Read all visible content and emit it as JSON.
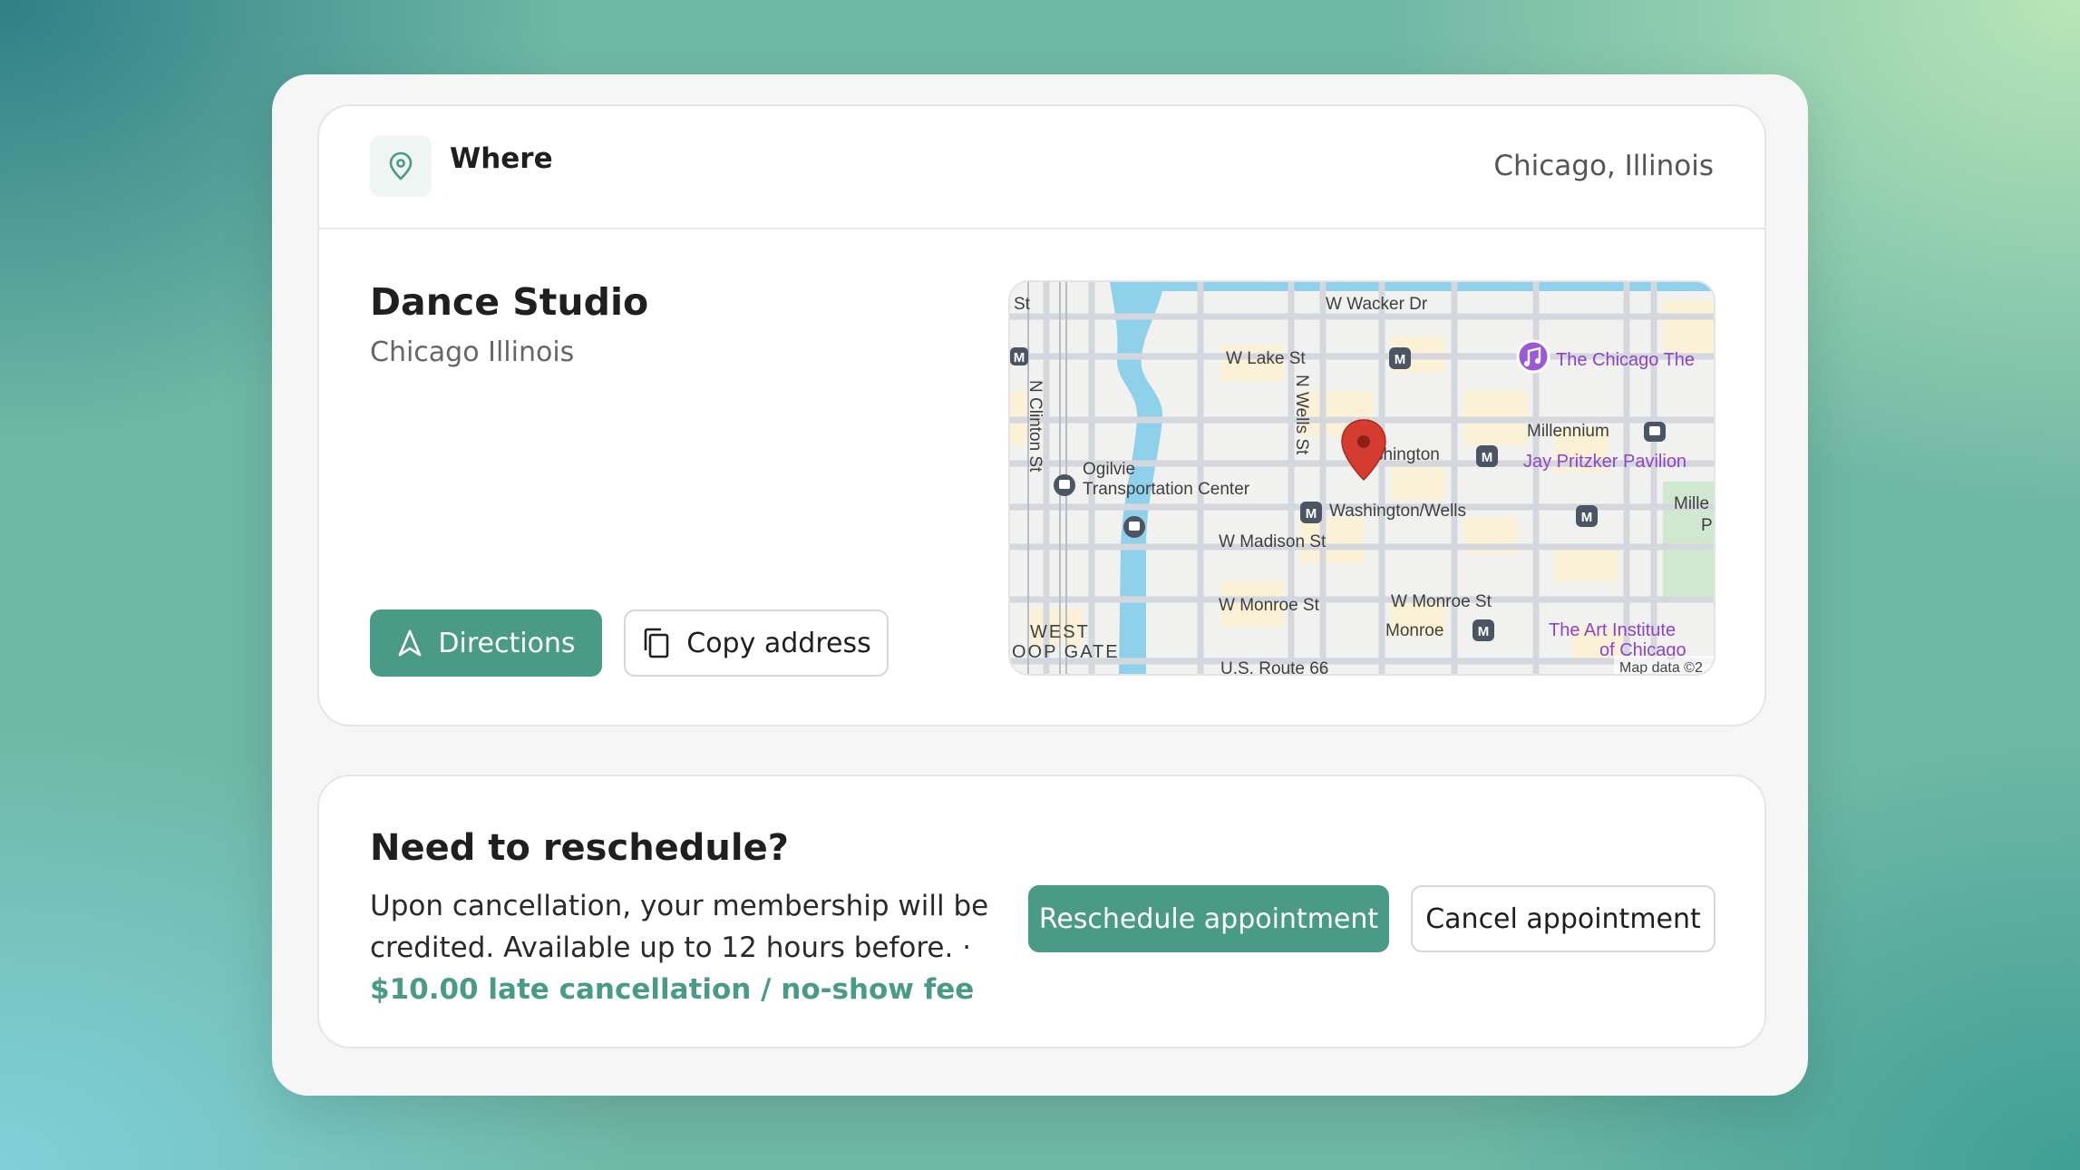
{
  "where": {
    "title": "Where",
    "location": "Chicago, Illinois",
    "icon": "map-pin-icon"
  },
  "studio": {
    "name": "Dance Studio",
    "city": "Chicago Illinois"
  },
  "buttons": {
    "directions": "Directions",
    "copy_address": "Copy address"
  },
  "map": {
    "labels": {
      "st": "St",
      "wacker": "W Wacker Dr",
      "lake": "W Lake St",
      "clinton": "N Clinton St",
      "wells": "N Wells St",
      "ogilvie1": "Ogilvie",
      "ogilvie2": "Transportation Center",
      "washington": "shington",
      "washington_wells": "Washington/Wells",
      "madison": "W Madison St",
      "monroe": "W Monroe St",
      "monroe2": "W Monroe St",
      "monroe_station": "Monroe",
      "west": "WEST",
      "loop_gate": "OOP GATE",
      "route66": "U.S. Route 66",
      "chicago_theatre": "The Chicago The",
      "millennium": "Millennium",
      "pritzker": "Jay Pritzker Pavilion",
      "mille": "Mille",
      "p": "P",
      "art1": "The Art Institute",
      "art2": "of Chicago",
      "credit": "Map data ©2",
      "metro": "M"
    }
  },
  "reschedule": {
    "title": "Need to reschedule?",
    "text": "Upon cancellation, your membership will be credited. Available up to 12 hours before. ·",
    "fee": "$10.00 late cancellation / no-show fee",
    "reschedule_btn": "Reschedule appointment",
    "cancel_btn": "Cancel appointment"
  },
  "colors": {
    "accent": "#4a9a88",
    "pin": "#d33c2f",
    "poi": "#9b59d6"
  }
}
